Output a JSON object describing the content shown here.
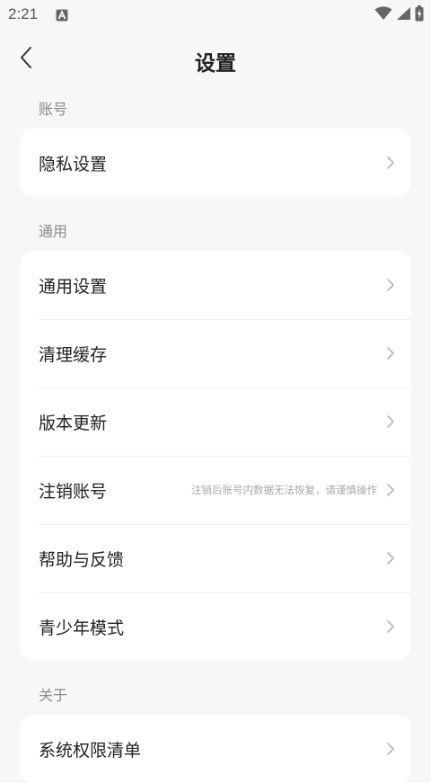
{
  "status_bar": {
    "time": "2:21",
    "notification_icon": "a-icon",
    "icons": [
      "wifi-icon",
      "signal-icon",
      "battery-charging-icon"
    ]
  },
  "header": {
    "title": "设置",
    "back_icon": "chevron-left-icon"
  },
  "sections": [
    {
      "label": "账号",
      "items": [
        {
          "label": "隐私设置"
        }
      ]
    },
    {
      "label": "通用",
      "items": [
        {
          "label": "通用设置"
        },
        {
          "label": "清理缓存"
        },
        {
          "label": "版本更新"
        },
        {
          "label": "注销账号",
          "hint": "注销后账号内数据无法恢复，请谨慎操作"
        },
        {
          "label": "帮助与反馈"
        },
        {
          "label": "青少年模式"
        }
      ]
    },
    {
      "label": "关于",
      "items": [
        {
          "label": "系统权限清单"
        }
      ]
    }
  ],
  "colors": {
    "background": "#f7f7f7",
    "card": "#ffffff",
    "section_label": "#8a8a8a",
    "chevron": "#b5b5b5",
    "hint": "#a8a8a8"
  }
}
